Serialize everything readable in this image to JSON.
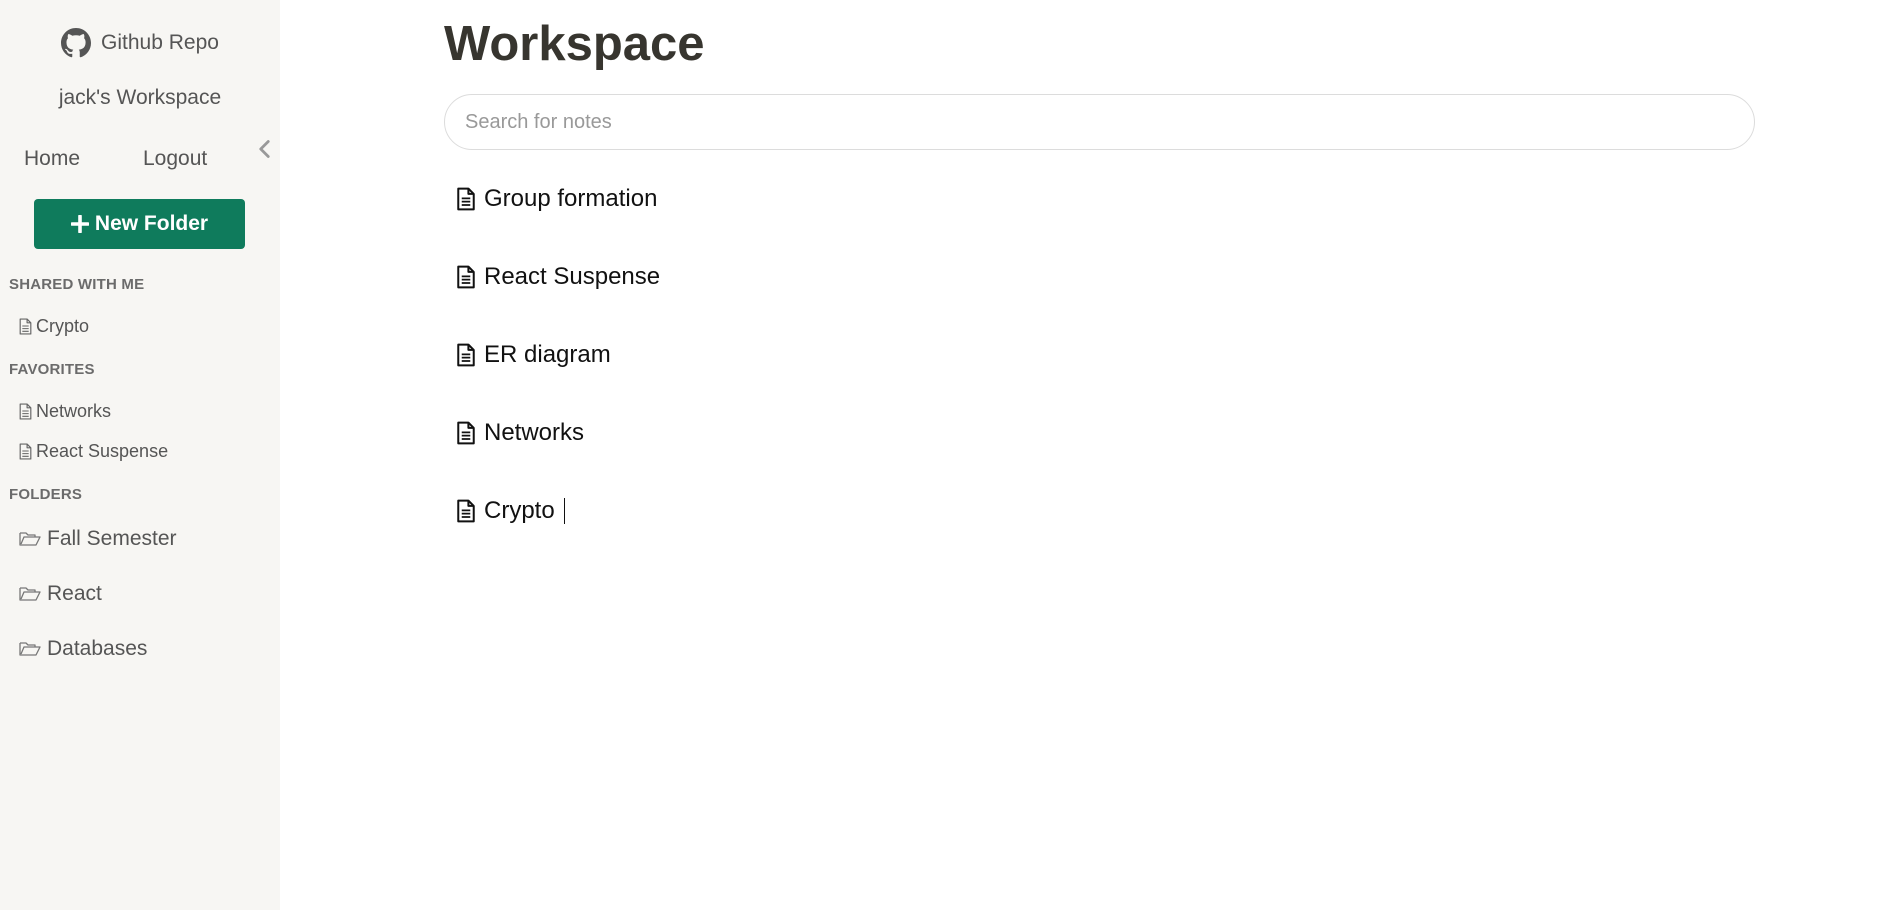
{
  "sidebar": {
    "github_label": "Github Repo",
    "workspace_name": "jack's Workspace",
    "nav": {
      "home": "Home",
      "logout": "Logout"
    },
    "new_folder_label": "New Folder",
    "sections": {
      "shared": "SHARED WITH ME",
      "favorites": "FAVORITES",
      "folders": "FOLDERS"
    },
    "shared_notes": [
      "Crypto"
    ],
    "favorite_notes": [
      "Networks",
      "React Suspense"
    ],
    "folders": [
      "Fall Semester",
      "React",
      "Databases"
    ]
  },
  "main": {
    "title": "Workspace",
    "search": {
      "placeholder": "Search for notes",
      "value": ""
    },
    "notes": [
      "Group formation",
      "React Suspense",
      "ER diagram",
      "Networks",
      "Crypto"
    ]
  },
  "colors": {
    "accent": "#0f7b5c",
    "sidebar_bg": "#f7f6f3",
    "title": "#37352f"
  },
  "icons": {
    "github": "github-icon",
    "collapse": "chevron-left-icon",
    "new_folder": "plus-icon",
    "note": "file-text-icon",
    "folder": "folder-open-icon"
  }
}
